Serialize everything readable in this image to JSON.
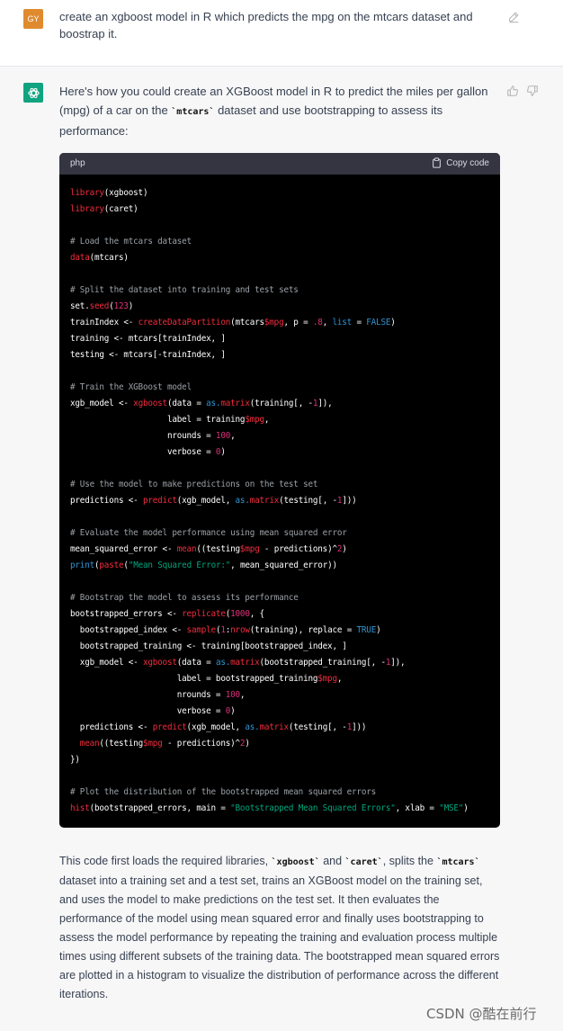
{
  "user": {
    "initials": "GY",
    "avatar_color": "#e08a2e",
    "message": "create an xgboost model in R which predicts the mpg on the mtcars dataset and boostrap it."
  },
  "assistant": {
    "avatar_color": "#10a37f",
    "intro_before": "Here's how you could create an XGBoost model in R to predict the miles per gallon (mpg) of a car on the ",
    "intro_code": "`mtcars`",
    "intro_after": " dataset and use bootstrapping to assess its performance:",
    "code_lang": "php",
    "copy_label": "Copy code",
    "after_1": "This code first loads the required libraries, ",
    "after_code_1": "`xgboost`",
    "after_2": " and ",
    "after_code_2": "`caret`",
    "after_3": ", splits the ",
    "after_code_3": "`mtcars`",
    "after_4": " dataset into a training set and a test set, trains an XGBoost model on the training set, and uses the model to make predictions on the test set. It then evaluates the performance of the model using mean squared error and finally uses bootstrapping to assess the model performance by repeating the training and evaluation process multiple times using different subsets of the training data. The bootstrapped mean squared errors are plotted in a histogram to visualize the distribution of performance across the different iterations."
  },
  "code_lines": [
    [
      [
        "kw",
        "library"
      ],
      [
        "",
        "(xgboost)"
      ]
    ],
    [
      [
        "kw",
        "library"
      ],
      [
        "",
        "(caret)"
      ]
    ],
    [],
    [
      [
        "cm",
        "# Load the mtcars dataset"
      ]
    ],
    [
      [
        "kw",
        "data"
      ],
      [
        "",
        "(mtcars)"
      ]
    ],
    [],
    [
      [
        "cm",
        "# Split the dataset into training and test sets"
      ]
    ],
    [
      [
        "",
        "set."
      ],
      [
        "kw",
        "seed"
      ],
      [
        "",
        "("
      ],
      [
        "num",
        "123"
      ],
      [
        "",
        ")"
      ]
    ],
    [
      [
        "",
        "trainIndex <- "
      ],
      [
        "kw",
        "createDataPartition"
      ],
      [
        "",
        "(mtcars"
      ],
      [
        "kw",
        "$mpg"
      ],
      [
        "",
        ", p = "
      ],
      [
        "num",
        ".8"
      ],
      [
        "",
        ", "
      ],
      [
        "bl",
        "list"
      ],
      [
        "",
        " = "
      ],
      [
        "bl",
        "FALSE"
      ],
      [
        "",
        ")"
      ]
    ],
    [
      [
        "",
        "training <- mtcars[trainIndex, ]"
      ]
    ],
    [
      [
        "",
        "testing <- mtcars[-trainIndex, ]"
      ]
    ],
    [],
    [
      [
        "cm",
        "# Train the XGBoost model"
      ]
    ],
    [
      [
        "",
        "xgb_model <- "
      ],
      [
        "kw",
        "xgboost"
      ],
      [
        "",
        "(data = "
      ],
      [
        "bl",
        "as."
      ],
      [
        "kw",
        "matrix"
      ],
      [
        "",
        "(training[, -"
      ],
      [
        "num",
        "1"
      ],
      [
        "",
        "]),"
      ]
    ],
    [
      [
        "",
        "                    label = training"
      ],
      [
        "kw",
        "$mpg"
      ],
      [
        "",
        ","
      ]
    ],
    [
      [
        "",
        "                    nrounds = "
      ],
      [
        "num",
        "100"
      ],
      [
        "",
        ","
      ]
    ],
    [
      [
        "",
        "                    verbose = "
      ],
      [
        "num",
        "0"
      ],
      [
        "",
        ")"
      ]
    ],
    [],
    [
      [
        "cm",
        "# Use the model to make predictions on the test set"
      ]
    ],
    [
      [
        "",
        "predictions <- "
      ],
      [
        "kw",
        "predict"
      ],
      [
        "",
        "(xgb_model, "
      ],
      [
        "bl",
        "as."
      ],
      [
        "kw",
        "matrix"
      ],
      [
        "",
        "(testing[, -"
      ],
      [
        "num",
        "1"
      ],
      [
        "",
        "]))"
      ]
    ],
    [],
    [
      [
        "cm",
        "# Evaluate the model performance using mean squared error"
      ]
    ],
    [
      [
        "",
        "mean_squared_error <- "
      ],
      [
        "kw",
        "mean"
      ],
      [
        "",
        "((testing"
      ],
      [
        "kw",
        "$mpg"
      ],
      [
        "",
        " - predictions)^"
      ],
      [
        "num",
        "2"
      ],
      [
        "",
        ")"
      ]
    ],
    [
      [
        "bl",
        "print"
      ],
      [
        "",
        "("
      ],
      [
        "kw",
        "paste"
      ],
      [
        "",
        "("
      ],
      [
        "str",
        "\"Mean Squared Error:\""
      ],
      [
        "",
        ", mean_squared_error))"
      ]
    ],
    [],
    [
      [
        "cm",
        "# Bootstrap the model to assess its performance"
      ]
    ],
    [
      [
        "",
        "bootstrapped_errors <- "
      ],
      [
        "kw",
        "replicate"
      ],
      [
        "",
        "("
      ],
      [
        "num",
        "1000"
      ],
      [
        "",
        ", {"
      ]
    ],
    [
      [
        "",
        "  bootstrapped_index <- "
      ],
      [
        "kw",
        "sample"
      ],
      [
        "",
        "("
      ],
      [
        "num",
        "1"
      ],
      [
        "",
        ":"
      ],
      [
        "kw",
        "nrow"
      ],
      [
        "",
        "(training), replace = "
      ],
      [
        "bl",
        "TRUE"
      ],
      [
        "",
        ")"
      ]
    ],
    [
      [
        "",
        "  bootstrapped_training <- training[bootstrapped_index, ]"
      ]
    ],
    [
      [
        "",
        "  xgb_model <- "
      ],
      [
        "kw",
        "xgboost"
      ],
      [
        "",
        "(data = "
      ],
      [
        "bl",
        "as."
      ],
      [
        "kw",
        "matrix"
      ],
      [
        "",
        "(bootstrapped_training[, -"
      ],
      [
        "num",
        "1"
      ],
      [
        "",
        "]),"
      ]
    ],
    [
      [
        "",
        "                      label = bootstrapped_training"
      ],
      [
        "kw",
        "$mpg"
      ],
      [
        "",
        ","
      ]
    ],
    [
      [
        "",
        "                      nrounds = "
      ],
      [
        "num",
        "100"
      ],
      [
        "",
        ","
      ]
    ],
    [
      [
        "",
        "                      verbose = "
      ],
      [
        "num",
        "0"
      ],
      [
        "",
        ")"
      ]
    ],
    [
      [
        "",
        "  predictions <- "
      ],
      [
        "kw",
        "predict"
      ],
      [
        "",
        "(xgb_model, "
      ],
      [
        "bl",
        "as."
      ],
      [
        "kw",
        "matrix"
      ],
      [
        "",
        "(testing[, -"
      ],
      [
        "num",
        "1"
      ],
      [
        "",
        "]))"
      ]
    ],
    [
      [
        "",
        "  "
      ],
      [
        "kw",
        "mean"
      ],
      [
        "",
        "((testing"
      ],
      [
        "kw",
        "$mpg"
      ],
      [
        "",
        " - predictions)^"
      ],
      [
        "num",
        "2"
      ],
      [
        "",
        ")"
      ]
    ],
    [
      [
        "",
        "})"
      ]
    ],
    [],
    [
      [
        "cm",
        "# Plot the distribution of the bootstrapped mean squared errors"
      ]
    ],
    [
      [
        "kw",
        "hist"
      ],
      [
        "",
        "(bootstrapped_errors, main = "
      ],
      [
        "str",
        "\"Bootstrapped Mean Squared Errors\""
      ],
      [
        "",
        ", xlab = "
      ],
      [
        "str",
        "\"MSE\""
      ],
      [
        "",
        ")"
      ]
    ]
  ],
  "watermark": "CSDN @酷在前行"
}
